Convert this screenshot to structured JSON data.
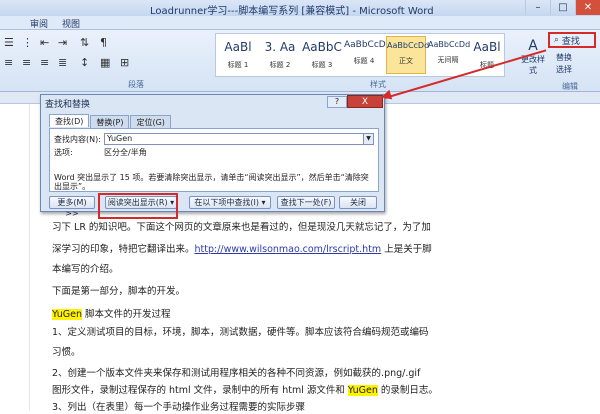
{
  "window": {
    "title": "Loadrunner学习---脚本编写系列 [兼容模式] - Microsoft Word",
    "min": "–",
    "max": "□",
    "close": "✕"
  },
  "menu": {
    "items": [
      "审阅",
      "视图"
    ]
  },
  "ribbon": {
    "groups": {
      "paragraph": "段落",
      "styles": "样式",
      "editing": "编辑"
    },
    "styles": [
      {
        "sample": "AaBl",
        "name": "标题 1"
      },
      {
        "sample": "3. Aa",
        "name": "标题 2"
      },
      {
        "sample": "AaBbC",
        "name": "标题 3"
      },
      {
        "sample": "AaBbCcD",
        "name": "标题 4"
      },
      {
        "sample": "AaBbCcDd",
        "name": "正文"
      },
      {
        "sample": "AaBbCcDd",
        "name": "无间隔"
      },
      {
        "sample": "AaBl",
        "name": "标题"
      }
    ],
    "change_styles": "更改样式",
    "editing": {
      "find": "查找",
      "replace": "替换",
      "select": "选择"
    }
  },
  "dialog": {
    "title": "查找和替换",
    "help": "?",
    "close": "X",
    "tabs": [
      "查找(D)",
      "替换(P)",
      "定位(G)"
    ],
    "find_label": "查找内容(N):",
    "find_value": "YuGen",
    "options_label": "选项:",
    "options_value": "区分全/半角",
    "info": "Word 突出显示了 15 项。若要清除突出显示，请单击“阅读突出显示”，然后单击“清除突出显示”。",
    "buttons": {
      "more": "更多(M) >>",
      "reading_highlight": "阅读突出显示(R) ▾",
      "find_in": "在以下项中查找(I) ▾",
      "find_next": "查找下一处(F)",
      "close": "关闭"
    }
  },
  "document": {
    "line1": "习下 LR 的知识吧。下面这个网页的文章原来也是看过的，但是现没几天就忘记了，为了加",
    "line2a": "深学习的印象，特把它翻译出来。",
    "line2link": "http://www.wilsonmao.com/lrscript.htm",
    "line2b": " 上是关于脚",
    "line3": "本编写的介绍。",
    "line4": "下面是第一部分，脚本的开发。",
    "line5hl": "YuGen",
    "line5": " 脚本文件的开发过程",
    "line6": "1、定义测试项目的目标，环境，脚本，测试数据，硬件等。脚本应该符合编码规范或编码",
    "line7": "习惯。",
    "line8": "2、创建一个版本文件夹来保存和测试用程序相关的各种不同资源，例如截获的.png/.gif",
    "line9a": "图形文件，录制过程保存的 html 文件，录制中的所有 html 源文件和 ",
    "line9hl": "YuGen",
    "line9b": " 的录制日志。",
    "line10": "3、列出（在表里）每一个手动操作业务过程需要的实际步骤"
  }
}
